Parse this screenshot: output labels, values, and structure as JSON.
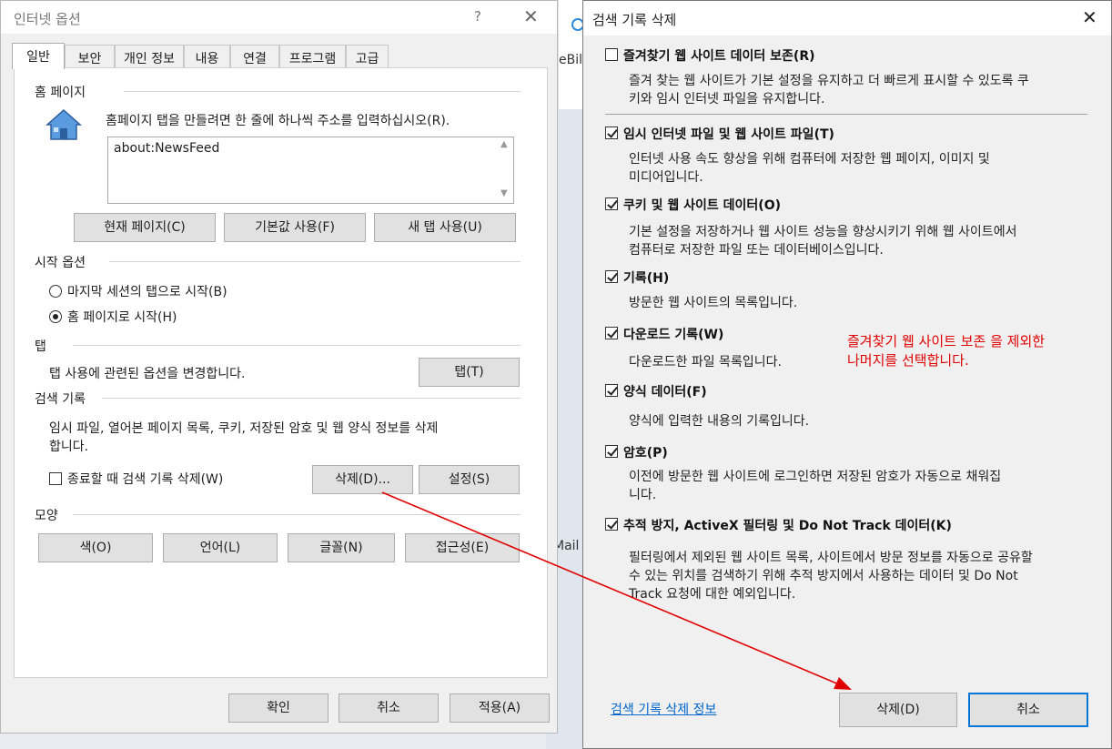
{
  "background": {
    "fragment_text_1": "eBill",
    "fragment_text_2": "Mail"
  },
  "left_dialog": {
    "title": "인터넷 옵션",
    "help": "?",
    "tabs": [
      "일반",
      "보안",
      "개인 정보",
      "내용",
      "연결",
      "프로그램",
      "고급"
    ],
    "home": {
      "label": "홈 페이지",
      "instruction": "홈페이지 탭을 만들려면 한 줄에 하나씩 주소를 입력하십시오(R).",
      "value": "about:NewsFeed",
      "buttons": [
        "현재 페이지(C)",
        "기본값 사용(F)",
        "새 탭 사용(U)"
      ]
    },
    "startup": {
      "label": "시작 옵션",
      "options": [
        "마지막 세션의 탭으로 시작(B)",
        "홈 페이지로 시작(H)"
      ],
      "selected_index": 1
    },
    "tabs_section": {
      "label": "탭",
      "desc": "탭 사용에 관련된 옵션을 변경합니다.",
      "button": "탭(T)"
    },
    "history": {
      "label": "검색 기록",
      "desc_line1": "임시 파일, 열어본 페이지 목록, 쿠키, 저장된 암호 및 웹 양식 정보를 삭제",
      "desc_line2": "합니다.",
      "checkbox_label": "종료할 때 검색 기록 삭제(W)",
      "checked": false,
      "delete_button": "삭제(D)...",
      "settings_button": "설정(S)"
    },
    "appearance": {
      "label": "모양",
      "buttons": [
        "색(O)",
        "언어(L)",
        "글꼴(N)",
        "접근성(E)"
      ]
    },
    "footer": {
      "ok": "확인",
      "cancel": "취소",
      "apply": "적용(A)"
    }
  },
  "right_dialog": {
    "title": "검색 기록 삭제",
    "options": [
      {
        "label": "즐겨찾기 웹 사이트 데이터 보존(R)",
        "checked": false,
        "desc": [
          "즐겨 찾는 웹 사이트가 기본 설정을 유지하고 더 빠르게 표시할 수 있도록 쿠",
          "키와 임시 인터넷 파일을 유지합니다."
        ]
      },
      {
        "label": "임시 인터넷 파일 및 웹 사이트 파일(T)",
        "checked": true,
        "desc": [
          "인터넷 사용 속도 향상을 위해 컴퓨터에 저장한 웹 페이지, 이미지 및",
          "미디어입니다."
        ]
      },
      {
        "label": "쿠키 및 웹 사이트 데이터(O)",
        "checked": true,
        "desc": [
          "기본 설정을 저장하거나 웹 사이트 성능을 향상시키기 위해 웹 사이트에서",
          "컴퓨터로 저장한 파일 또는 데이터베이스입니다."
        ]
      },
      {
        "label": "기록(H)",
        "checked": true,
        "desc": [
          "방문한 웹 사이트의 목록입니다."
        ]
      },
      {
        "label": "다운로드 기록(W)",
        "checked": true,
        "desc": [
          "다운로드한 파일 목록입니다."
        ]
      },
      {
        "label": "양식 데이터(F)",
        "checked": true,
        "desc": [
          "양식에 입력한 내용의 기록입니다."
        ]
      },
      {
        "label": "암호(P)",
        "checked": true,
        "desc": [
          "이전에 방문한 웹 사이트에 로그인하면 저장된 암호가 자동으로 채워집",
          "니다."
        ]
      },
      {
        "label": "추적 방지, ActiveX 필터링 및 Do Not Track 데이터(K)",
        "checked": true,
        "desc": [
          "필터링에서 제외된 웹 사이트 목록, 사이트에서 방문 정보를 자동으로 공유할",
          "수 있는 위치를 검색하기 위해 추적 방지에서 사용하는 데이터 및 Do Not",
          "Track 요청에 대한 예외입니다."
        ]
      }
    ],
    "annotation_line1": "즐겨찾기 웹 사이트 보존 을 제외한",
    "annotation_line2": "나머지를 선택합니다.",
    "info_link": "검색 기록 삭제 정보",
    "delete_button": "삭제(D)",
    "cancel_button": "취소"
  },
  "colors": {
    "annotation": "#e00000",
    "arrow": "#e00000",
    "link": "#0066cc",
    "focus": "#0078d7"
  }
}
